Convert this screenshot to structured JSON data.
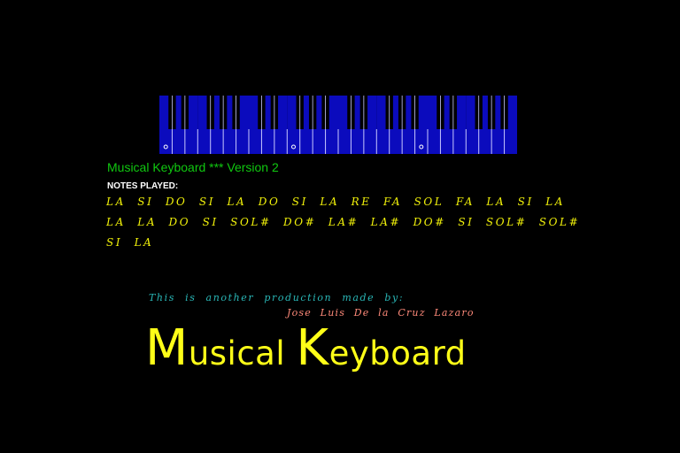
{
  "colors": {
    "background": "#000000",
    "key_blue": "#0b0bbd",
    "key_line": "#c8c8ff",
    "marker": "#ffffff",
    "title": "#10c810",
    "label": "#ffffff",
    "notes": "#f2f20a",
    "credit": "#2ab8b8",
    "author": "#ff8a7a",
    "logo": "#ffff18"
  },
  "keyboard": {
    "white_key_count": 28,
    "black_key_pattern": [
      1,
      1,
      0,
      1,
      1,
      1,
      0
    ],
    "marked_white_keys": [
      0,
      10,
      20
    ]
  },
  "title": "Musical Keyboard *** Version 2",
  "notes_label": "NOTES PLAYED:",
  "notes_played": "LA SI DO SI LA DO SI LA RE FA SOL FA LA SI LA LA LA DO SI SOL# DO# LA# LA# DO# SI SOL# SOL# SI LA",
  "credit_line": "This is another production made by:",
  "author": "Jose Luis De la Cruz Lazaro",
  "logo": {
    "word1_initial": "M",
    "word1_rest": "usical",
    "word2_initial": "K",
    "word2_rest": "eyboard"
  }
}
